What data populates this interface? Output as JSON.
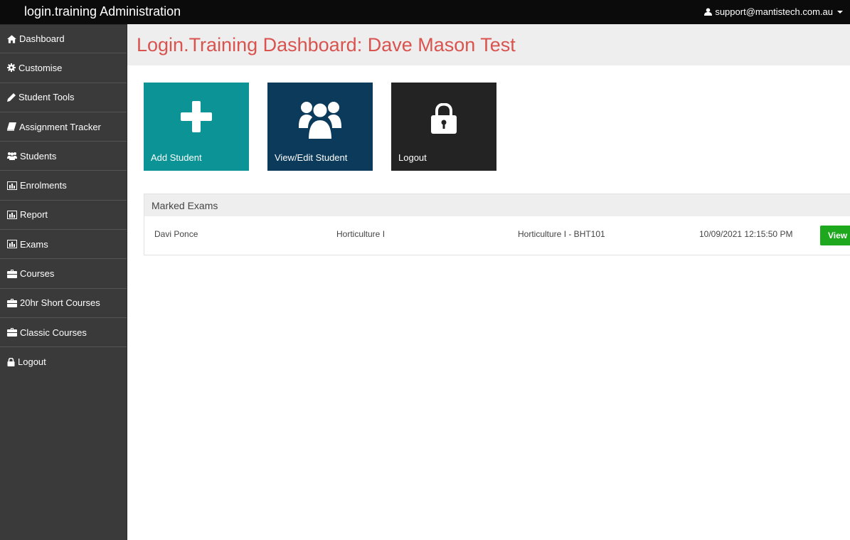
{
  "app": {
    "title": "login.training Administration",
    "user_email": "support@mantistech.com.au"
  },
  "sidebar": {
    "items": [
      {
        "label": "Dashboard",
        "icon": "home-icon"
      },
      {
        "label": "Customise",
        "icon": "gear-icon"
      },
      {
        "label": "Student Tools",
        "icon": "pencil-icon"
      },
      {
        "label": "Assignment Tracker",
        "icon": "book-icon"
      },
      {
        "label": "Students",
        "icon": "users-icon"
      },
      {
        "label": "Enrolments",
        "icon": "bar-chart-icon"
      },
      {
        "label": "Report",
        "icon": "bar-chart-icon"
      },
      {
        "label": "Exams",
        "icon": "bar-chart-icon"
      },
      {
        "label": "Courses",
        "icon": "briefcase-icon"
      },
      {
        "label": "20hr Short Courses",
        "icon": "briefcase-icon"
      },
      {
        "label": "Classic Courses",
        "icon": "briefcase-icon"
      },
      {
        "label": "Logout",
        "icon": "lock-icon"
      }
    ]
  },
  "main": {
    "title": "Login.Training Dashboard: Dave Mason Test",
    "tiles": [
      {
        "label": "Add Student",
        "icon": "plus-icon",
        "color": "#0b9396"
      },
      {
        "label": "View/Edit Student",
        "icon": "users-icon",
        "color": "#0b3a5a"
      },
      {
        "label": "Logout",
        "icon": "lock-icon",
        "color": "#232323"
      }
    ],
    "marked_exams": {
      "heading": "Marked Exams",
      "rows": [
        {
          "student": "Davi Ponce",
          "course": "Horticulture I",
          "unit": "Horticulture I - BHT101",
          "date": "10/09/2021 12:15:50 PM",
          "action": "View"
        }
      ]
    }
  },
  "colors": {
    "topbar": "#0b0b0b",
    "sidebar": "#3a3a3a",
    "title": "#d9534f",
    "view_button": "#1ea81e"
  }
}
